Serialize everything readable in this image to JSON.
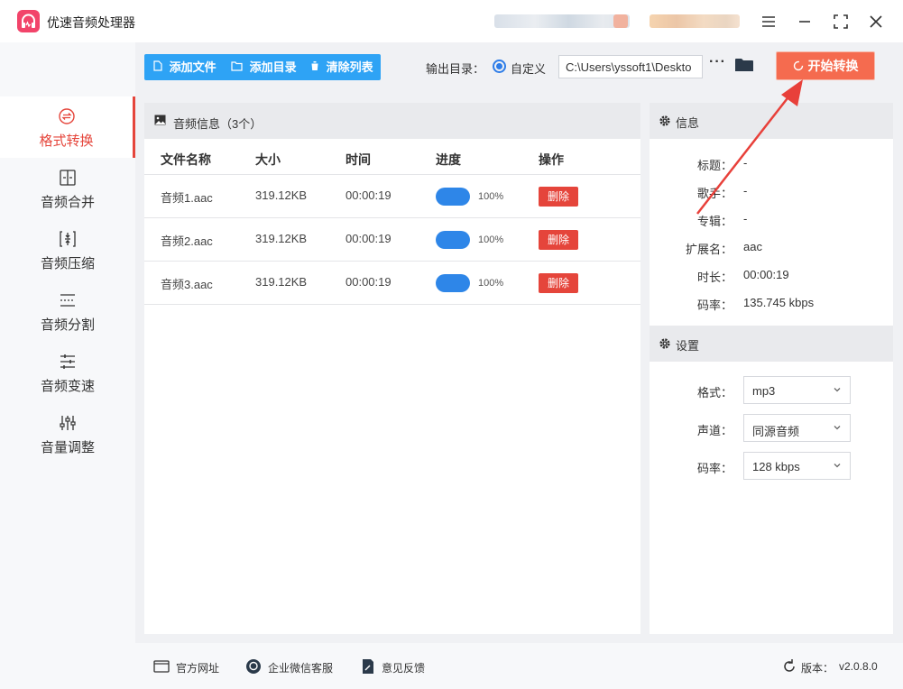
{
  "window": {
    "title": "优速音频处理器",
    "minimize_icon": "minimize-icon",
    "maximize_icon": "maximize-icon",
    "close_icon": "close-icon",
    "menu_icon": "menu-icon"
  },
  "sidebar": {
    "items": [
      {
        "label": "格式转换",
        "icon": "format-convert-icon",
        "active": true
      },
      {
        "label": "音频合并",
        "icon": "merge-icon",
        "active": false
      },
      {
        "label": "音频压缩",
        "icon": "compress-icon",
        "active": false
      },
      {
        "label": "音频分割",
        "icon": "split-icon",
        "active": false
      },
      {
        "label": "音频变速",
        "icon": "speed-icon",
        "active": false
      },
      {
        "label": "音量调整",
        "icon": "volume-icon",
        "active": false
      }
    ]
  },
  "toolbar": {
    "add_file": "添加文件",
    "add_dir": "添加目录",
    "clear_list": "清除列表",
    "output_label": "输出目录：",
    "custom_label": "自定义",
    "output_path": "C:\\Users\\yssoft1\\Deskto",
    "more": "···",
    "start": "开始转换"
  },
  "files": {
    "header": "音频信息（3个）",
    "columns": [
      "文件名称",
      "大小",
      "时间",
      "进度",
      "操作"
    ],
    "rows": [
      {
        "name": "音频1.aac",
        "size": "319.12KB",
        "time": "00:00:19",
        "progress": "100%",
        "action": "删除"
      },
      {
        "name": "音频2.aac",
        "size": "319.12KB",
        "time": "00:00:19",
        "progress": "100%",
        "action": "删除"
      },
      {
        "name": "音频3.aac",
        "size": "319.12KB",
        "time": "00:00:19",
        "progress": "100%",
        "action": "删除"
      }
    ]
  },
  "info": {
    "header": "信息",
    "fields": [
      {
        "label": "标题：",
        "value": "-"
      },
      {
        "label": "歌手：",
        "value": "-"
      },
      {
        "label": "专辑：",
        "value": "-"
      },
      {
        "label": "扩展名：",
        "value": "aac"
      },
      {
        "label": "时长：",
        "value": "00:00:19"
      },
      {
        "label": "码率：",
        "value": "135.745 kbps"
      }
    ]
  },
  "settings": {
    "header": "设置",
    "fields": [
      {
        "label": "格式：",
        "value": "mp3"
      },
      {
        "label": "声道：",
        "value": "同源音频"
      },
      {
        "label": "码率：",
        "value": "128 kbps"
      }
    ]
  },
  "footer": {
    "website": "官方网址",
    "wechat": "企业微信客服",
    "feedback": "意见反馈",
    "version_label": "版本：",
    "version": "v2.0.8.0"
  },
  "colors": {
    "accent_red": "#e5453b",
    "accent_blue": "#2ea3f5",
    "start_button": "#f56b4f",
    "progress_pill": "#2e86e8"
  }
}
